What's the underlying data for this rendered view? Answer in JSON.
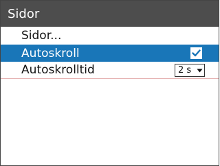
{
  "window": {
    "title": "Sidor"
  },
  "menu": {
    "items": [
      {
        "label": "Sidor..."
      },
      {
        "label": "Autoskroll",
        "checked": true,
        "icon": "checkmark-icon"
      },
      {
        "label": "Autoskrolltid",
        "value": "2 s",
        "icon": "dropdown-arrow-icon"
      }
    ]
  },
  "colors": {
    "titlebar": "#4d4d4d",
    "selection": "#1976b8",
    "divider": "#e6b3b3"
  }
}
